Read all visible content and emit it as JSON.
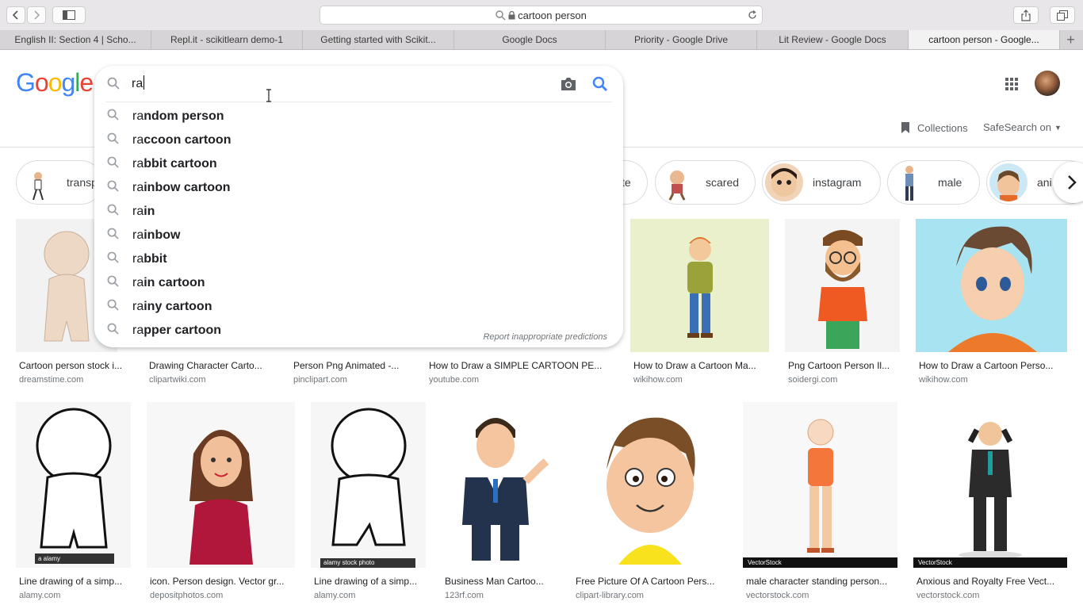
{
  "browser": {
    "url": "cartoon person",
    "tabs": [
      {
        "label": "English II: Section 4 | Scho...",
        "active": false
      },
      {
        "label": "Repl.it - scikitlearn demo-1",
        "active": false
      },
      {
        "label": "Getting started with Scikit...",
        "active": false
      },
      {
        "label": "Google Docs",
        "active": false
      },
      {
        "label": "Priority - Google Drive",
        "active": false
      },
      {
        "label": "Lit Review - Google Docs",
        "active": false
      },
      {
        "label": "cartoon person - Google...",
        "active": true
      }
    ],
    "new_tab": "+"
  },
  "search": {
    "query": "ra",
    "suggestions": [
      {
        "prefix": "ra",
        "rest": "ndom person"
      },
      {
        "prefix": "ra",
        "rest": "ccoon cartoon"
      },
      {
        "prefix": "ra",
        "rest": "bbit cartoon"
      },
      {
        "prefix": "ra",
        "rest": "inbow cartoon"
      },
      {
        "prefix": "ra",
        "rest": "in"
      },
      {
        "prefix": "ra",
        "rest": "inbow"
      },
      {
        "prefix": "ra",
        "rest": "bbit"
      },
      {
        "prefix": "ra",
        "rest": "in cartoon"
      },
      {
        "prefix": "ra",
        "rest": "iny cartoon"
      },
      {
        "prefix": "ra",
        "rest": "pper cartoon"
      }
    ],
    "report_label": "Report inappropriate predictions"
  },
  "header": {
    "collections_label": "Collections",
    "safesearch_label": "SafeSearch on"
  },
  "chips": [
    {
      "label": "transp"
    },
    {
      "label": "te"
    },
    {
      "label": "scared"
    },
    {
      "label": "instagram"
    },
    {
      "label": "male"
    },
    {
      "label": "ani"
    }
  ],
  "results_row1": [
    {
      "title": "Cartoon person stock i...",
      "source": "dreamstime.com"
    },
    {
      "title": "Drawing Character Carto...",
      "source": "clipartwiki.com"
    },
    {
      "title": "Person Png Animated -...",
      "source": "pinclipart.com"
    },
    {
      "title": "How to Draw a SIMPLE CARTOON PE...",
      "source": "youtube.com"
    },
    {
      "title": "How to Draw a Cartoon Ma...",
      "source": "wikihow.com"
    },
    {
      "title": "Png Cartoon Person Il...",
      "source": "soidergi.com"
    },
    {
      "title": "How to Draw a Cartoon Perso...",
      "source": "wikihow.com"
    }
  ],
  "results_row2": [
    {
      "title": "Line drawing of a simp...",
      "source": "alamy.com",
      "badge": "a alamy"
    },
    {
      "title": "icon. Person design. Vector gr...",
      "source": "depositphotos.com"
    },
    {
      "title": "Line drawing of a simp...",
      "source": "alamy.com",
      "badge": "alamy stock photo"
    },
    {
      "title": "Business Man Cartoo...",
      "source": "123rf.com"
    },
    {
      "title": "Free Picture Of A Cartoon Pers...",
      "source": "clipart-library.com"
    },
    {
      "title": "male character standing person...",
      "source": "vectorstock.com",
      "badge": "VectorStock"
    },
    {
      "title": "Anxious and Royalty Free Vect...",
      "source": "vectorstock.com",
      "badge": "VectorStock"
    }
  ],
  "colors": {
    "google_blue": "#4285f4",
    "google_red": "#ea4335",
    "google_yellow": "#fbbc05",
    "google_green": "#34a853"
  }
}
